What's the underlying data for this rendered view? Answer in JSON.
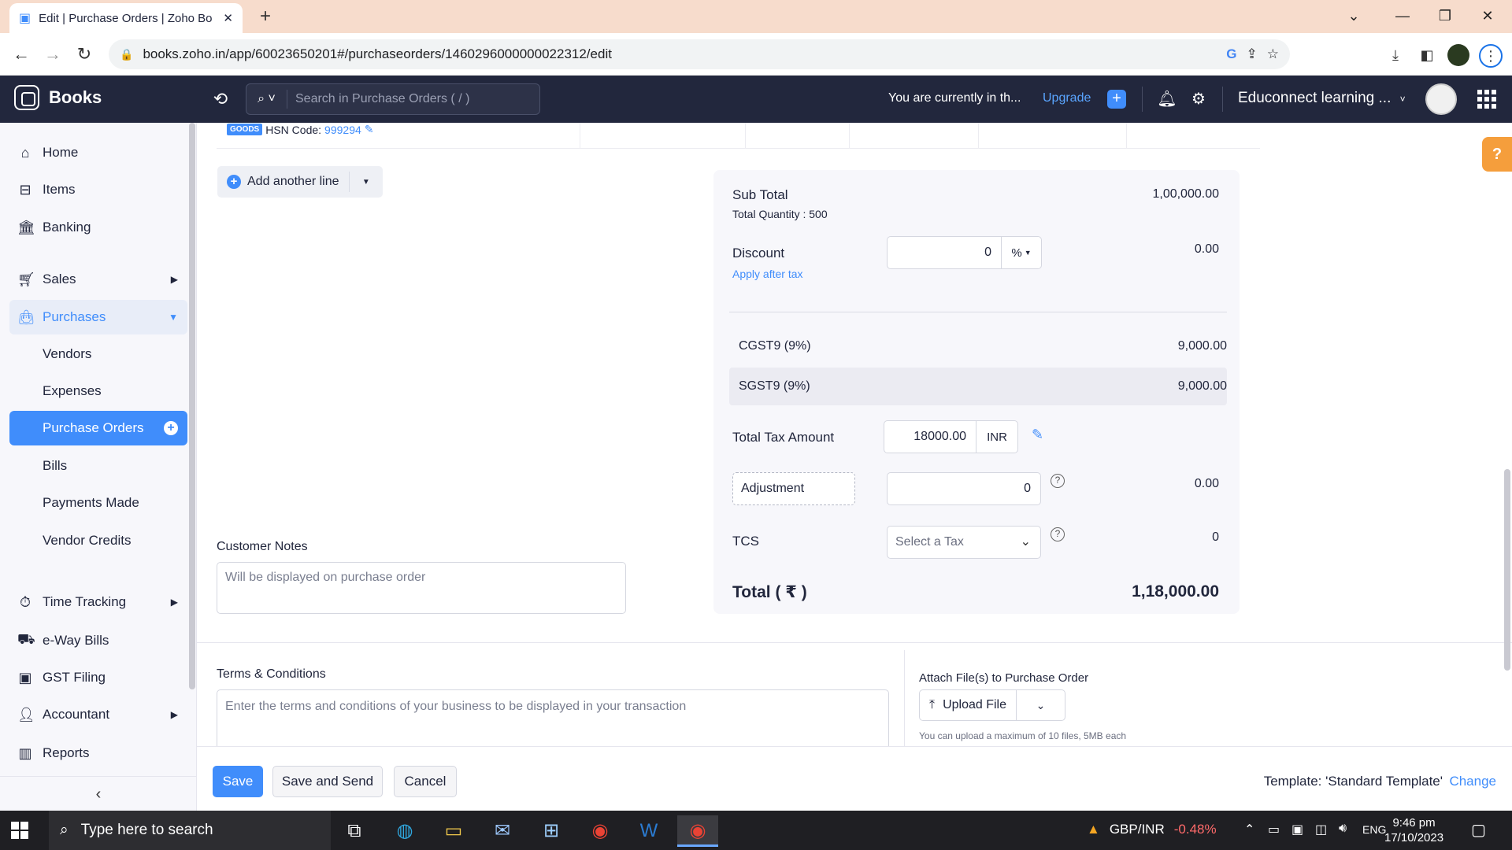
{
  "browser": {
    "tab_title": "Edit | Purchase Orders | Zoho Bo",
    "url": "books.zoho.in/app/60023650201#/purchaseorders/1460296000000022312/edit"
  },
  "header": {
    "brand": "Books",
    "search_placeholder": "Search in Purchase Orders ( / )",
    "org_message": "You are currently in th...",
    "upgrade": "Upgrade",
    "org_name": "Educonnect learning ..."
  },
  "sidebar": {
    "items": {
      "home": "Home",
      "items": "Items",
      "banking": "Banking",
      "sales": "Sales",
      "purchases": "Purchases",
      "vendors": "Vendors",
      "expenses": "Expenses",
      "purchase_orders": "Purchase Orders",
      "bills": "Bills",
      "payments_made": "Payments Made",
      "vendor_credits": "Vendor Credits",
      "time_tracking": "Time Tracking",
      "eway_bills": "e-Way Bills",
      "gst_filing": "GST Filing",
      "accountant": "Accountant",
      "reports": "Reports"
    }
  },
  "line_item": {
    "goods_badge": "GOODS",
    "hsn_label": "HSN Code:",
    "hsn_code": "999294"
  },
  "add_line": "Add another line",
  "totals": {
    "sub_total_label": "Sub Total",
    "sub_total_value": "1,00,000.00",
    "total_quantity": "Total Quantity : 500",
    "discount_label": "Discount",
    "discount_input": "0",
    "discount_unit": "%",
    "discount_value": "0.00",
    "apply_after_tax": "Apply after tax",
    "taxes": [
      {
        "label": "CGST9 (9%)",
        "value": "9,000.00"
      },
      {
        "label": "SGST9 (9%)",
        "value": "9,000.00"
      }
    ],
    "total_tax_label": "Total Tax Amount",
    "total_tax_input": "18000.00",
    "total_tax_currency": "INR",
    "adjustment_label": "Adjustment",
    "adjustment_input": "0",
    "adjustment_value": "0.00",
    "tcs_label": "TCS",
    "tcs_placeholder": "Select a Tax",
    "tcs_value": "0",
    "total_label": "Total ( ₹ )",
    "total_value": "1,18,000.00"
  },
  "customer_notes": {
    "label": "Customer Notes",
    "placeholder": "Will be displayed on purchase order"
  },
  "terms": {
    "label": "Terms & Conditions",
    "placeholder": "Enter the terms and conditions of your business to be displayed in your transaction"
  },
  "attach": {
    "label": "Attach File(s) to Purchase Order",
    "upload": "Upload File",
    "hint": "You can upload a maximum of 10 files, 5MB each"
  },
  "footer": {
    "save": "Save",
    "save_send": "Save and Send",
    "cancel": "Cancel",
    "template": "Template: 'Standard Template'",
    "change": "Change"
  },
  "taskbar": {
    "search": "Type here to search",
    "ticker_pair": "GBP/INR",
    "ticker_change": "-0.48%",
    "lang": "ENG",
    "time": "9:46 pm",
    "date": "17/10/2023"
  }
}
